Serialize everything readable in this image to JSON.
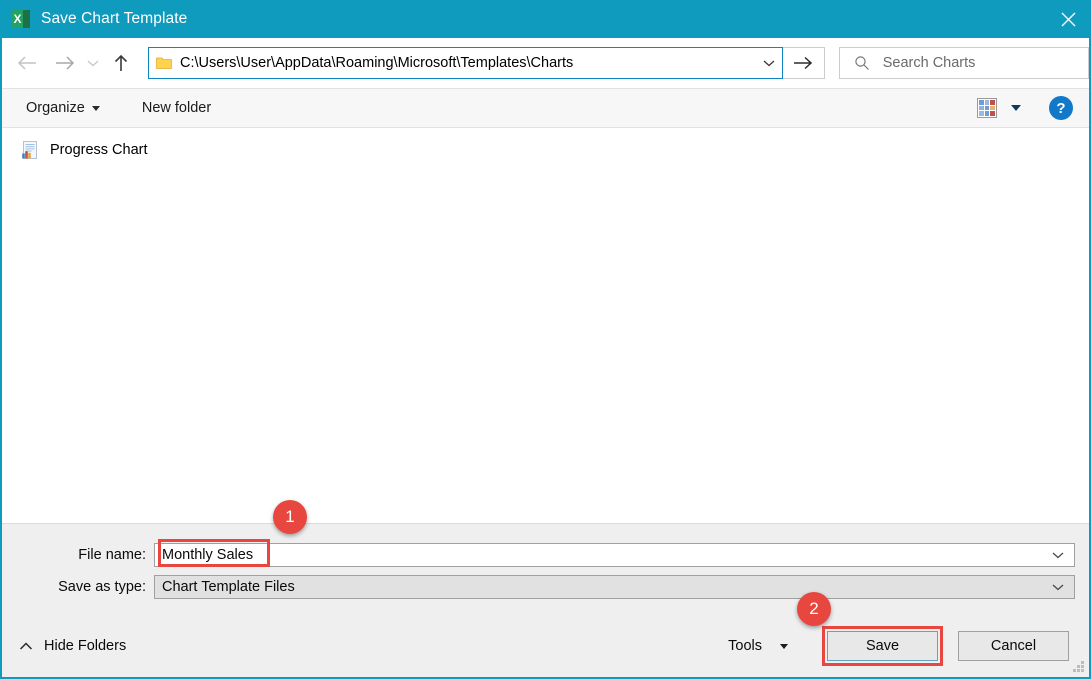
{
  "window": {
    "title": "Save Chart Template",
    "app_icon": "excel-icon",
    "app_icon_letter": "X",
    "close_icon": "close-icon",
    "titlebar_color": "#0f9bbd"
  },
  "navbar": {
    "back_icon": "back-arrow-icon",
    "forward_icon": "forward-arrow-icon",
    "recent_icon": "chevron-down-icon",
    "up_icon": "up-arrow-icon",
    "folder_icon": "folder-icon",
    "address": "C:\\Users\\User\\AppData\\Roaming\\Microsoft\\Templates\\Charts",
    "address_dropdown_icon": "chevron-down-icon",
    "go_icon": "go-arrow-icon",
    "search_icon": "search-icon",
    "search_placeholder": "Search Charts"
  },
  "toolbar": {
    "organize_label": "Organize",
    "new_folder_label": "New folder",
    "view_icon": "view-grid-icon",
    "view_caret_icon": "chevron-down-icon",
    "help_label": "?",
    "help_icon": "help-icon"
  },
  "filelist": {
    "items": [
      {
        "name": "Progress Chart",
        "icon": "chart-template-file-icon"
      }
    ]
  },
  "bottom": {
    "filename_label": "File name:",
    "filename_value": "Monthly Sales",
    "filename_dropdown_icon": "chevron-down-icon",
    "filetype_label": "Save as type:",
    "filetype_value": "Chart Template Files",
    "filetype_dropdown_icon": "chevron-down-icon",
    "hide_folders_label": "Hide Folders",
    "hide_folders_icon": "chevron-up-icon",
    "tools_label": "Tools",
    "tools_caret_icon": "chevron-down-icon",
    "save_label": "Save",
    "cancel_label": "Cancel"
  },
  "annotations": {
    "badge_color": "#e8473f",
    "badges": [
      {
        "number": "1"
      },
      {
        "number": "2"
      }
    ]
  }
}
